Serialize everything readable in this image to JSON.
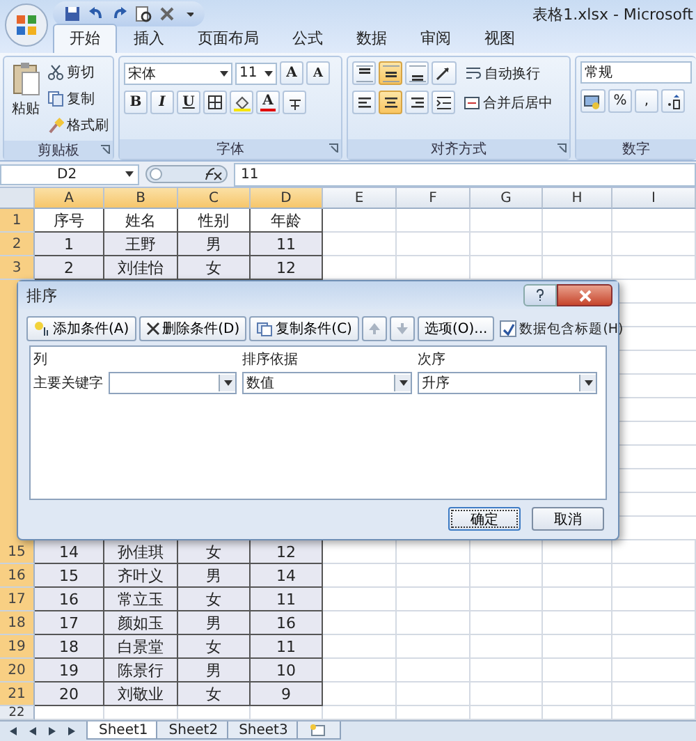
{
  "title_bar": {
    "title": "表格1.xlsx - Microsoft"
  },
  "ribbon_tabs": [
    {
      "label": "开始",
      "selected": true
    },
    {
      "label": "插入",
      "selected": false
    },
    {
      "label": "页面布局",
      "selected": false
    },
    {
      "label": "公式",
      "selected": false
    },
    {
      "label": "数据",
      "selected": false
    },
    {
      "label": "审阅",
      "selected": false
    },
    {
      "label": "视图",
      "selected": false
    }
  ],
  "clipboard": {
    "paste": "粘贴",
    "cut": "剪切",
    "copy": "复制",
    "format_painter": "格式刷",
    "label": "剪贴板"
  },
  "font": {
    "font_name": "宋体",
    "font_size": "11",
    "grow": "A",
    "shrink": "A",
    "bold": "B",
    "italic": "I",
    "underline": "U",
    "font_color": "A",
    "label": "字体"
  },
  "alignment": {
    "vertical": [
      {
        "selected": false
      },
      {
        "selected": true
      },
      {
        "selected": false
      }
    ],
    "horizontal": [
      {
        "selected": false
      },
      {
        "selected": true
      },
      {
        "selected": false
      }
    ],
    "wrap_text": "自动换行",
    "merge_center": "合并后居中",
    "label": "对齐方式"
  },
  "number": {
    "format": "常规",
    "percent": "%",
    "comma": ",",
    "label": "数字"
  },
  "formula_bar": {
    "name_box": "D2",
    "value": "11"
  },
  "sheet": {
    "columns": [
      {
        "label": "A",
        "selected": true
      },
      {
        "label": "B",
        "selected": true
      },
      {
        "label": "C",
        "selected": true
      },
      {
        "label": "D",
        "selected": true
      },
      {
        "label": "E",
        "selected": false
      },
      {
        "label": "F",
        "selected": false
      },
      {
        "label": "G",
        "selected": false
      },
      {
        "label": "H",
        "selected": false
      },
      {
        "label": "I",
        "selected": false
      }
    ],
    "rows_above": [
      {
        "number": "1",
        "selected": true,
        "cells": [
          "序号",
          "姓名",
          "性别",
          "年龄"
        ]
      },
      {
        "number": "2",
        "selected": true,
        "cells": [
          "1",
          "王野",
          "男",
          "11"
        ]
      },
      {
        "number": "3",
        "selected": true,
        "cells": [
          "2",
          "刘佳怡",
          "女",
          "12"
        ]
      }
    ],
    "rows_below": [
      {
        "number": "15",
        "selected": true,
        "cells": [
          "14",
          "孙佳琪",
          "女",
          "12"
        ]
      },
      {
        "number": "16",
        "selected": true,
        "cells": [
          "15",
          "齐叶义",
          "男",
          "14"
        ]
      },
      {
        "number": "17",
        "selected": true,
        "cells": [
          "16",
          "常立玉",
          "女",
          "11"
        ]
      },
      {
        "number": "18",
        "selected": true,
        "cells": [
          "17",
          "颜如玉",
          "男",
          "16"
        ]
      },
      {
        "number": "19",
        "selected": true,
        "cells": [
          "18",
          "白景堂",
          "女",
          "11"
        ]
      },
      {
        "number": "20",
        "selected": true,
        "cells": [
          "19",
          "陈景行",
          "男",
          "10"
        ]
      },
      {
        "number": "21",
        "selected": true,
        "cells": [
          "20",
          "刘敬业",
          "女",
          "9"
        ]
      },
      {
        "number": "22",
        "selected": false
      }
    ]
  },
  "sort_dialog": {
    "title": "排序",
    "add_level": "添加条件(A)",
    "delete_level": "删除条件(D)",
    "copy_level": "复制条件(C)",
    "options": "选项(O)...",
    "has_headers": {
      "label": "数据包含标题(H)",
      "checked": true
    },
    "columns": [
      "列",
      "排序依据",
      "次序"
    ],
    "levels": [
      {
        "label": "主要关键字",
        "sort_on": "数值",
        "order": "升序"
      }
    ],
    "ok": "确定",
    "cancel": "取消"
  },
  "sheet_tabs": [
    {
      "label": "Sheet1",
      "selected": true
    },
    {
      "label": "Sheet2",
      "selected": false
    },
    {
      "label": "Sheet3",
      "selected": false
    }
  ]
}
